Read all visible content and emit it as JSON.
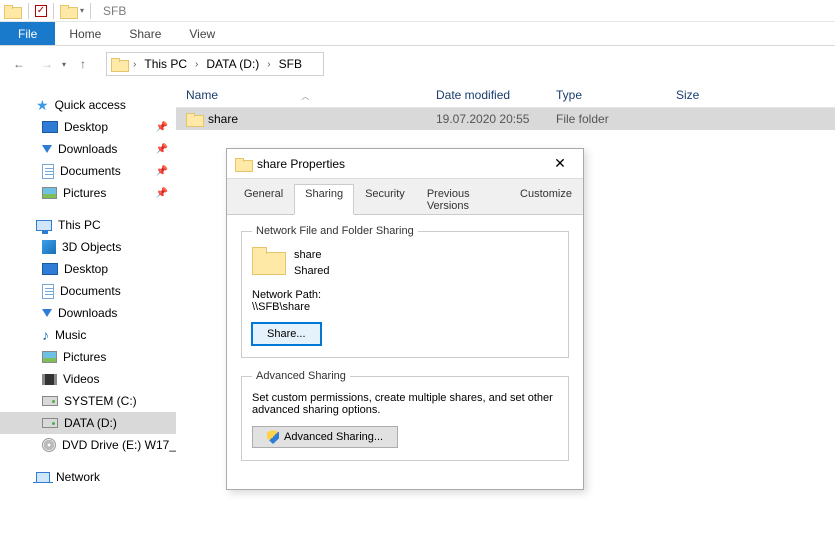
{
  "titlebar": {
    "title": "SFB"
  },
  "ribbon": {
    "file": "File",
    "tabs": [
      "Home",
      "Share",
      "View"
    ]
  },
  "breadcrumb": {
    "items": [
      "This PC",
      "DATA (D:)",
      "SFB"
    ]
  },
  "columns": {
    "name": "Name",
    "date": "Date modified",
    "type": "Type",
    "size": "Size"
  },
  "rows": [
    {
      "name": "share",
      "date": "19.07.2020 20:55",
      "type": "File folder",
      "size": ""
    }
  ],
  "sidebar": {
    "quick_access": {
      "label": "Quick access",
      "items": [
        {
          "label": "Desktop",
          "icon": "desktop",
          "pinned": true
        },
        {
          "label": "Downloads",
          "icon": "down",
          "pinned": true
        },
        {
          "label": "Documents",
          "icon": "doc",
          "pinned": true
        },
        {
          "label": "Pictures",
          "icon": "pic",
          "pinned": true
        }
      ]
    },
    "this_pc": {
      "label": "This PC",
      "items": [
        {
          "label": "3D Objects",
          "icon": "cube"
        },
        {
          "label": "Desktop",
          "icon": "desktop"
        },
        {
          "label": "Documents",
          "icon": "doc"
        },
        {
          "label": "Downloads",
          "icon": "down"
        },
        {
          "label": "Music",
          "icon": "music"
        },
        {
          "label": "Pictures",
          "icon": "pic"
        },
        {
          "label": "Videos",
          "icon": "video"
        },
        {
          "label": "SYSTEM (C:)",
          "icon": "drive"
        },
        {
          "label": "DATA (D:)",
          "icon": "drive",
          "selected": true
        },
        {
          "label": "DVD Drive (E:) W17_",
          "icon": "dvd"
        }
      ]
    },
    "network": {
      "label": "Network"
    }
  },
  "dialog": {
    "title": "share Properties",
    "tabs": [
      "General",
      "Sharing",
      "Security",
      "Previous Versions",
      "Customize"
    ],
    "active_tab": "Sharing",
    "net_group": {
      "legend": "Network File and Folder Sharing",
      "name": "share",
      "status": "Shared",
      "path_label": "Network Path:",
      "path": "\\\\SFB\\share",
      "share_btn": "Share..."
    },
    "adv_group": {
      "legend": "Advanced Sharing",
      "desc": "Set custom permissions, create multiple shares, and set other advanced sharing options.",
      "btn": "Advanced Sharing..."
    }
  }
}
